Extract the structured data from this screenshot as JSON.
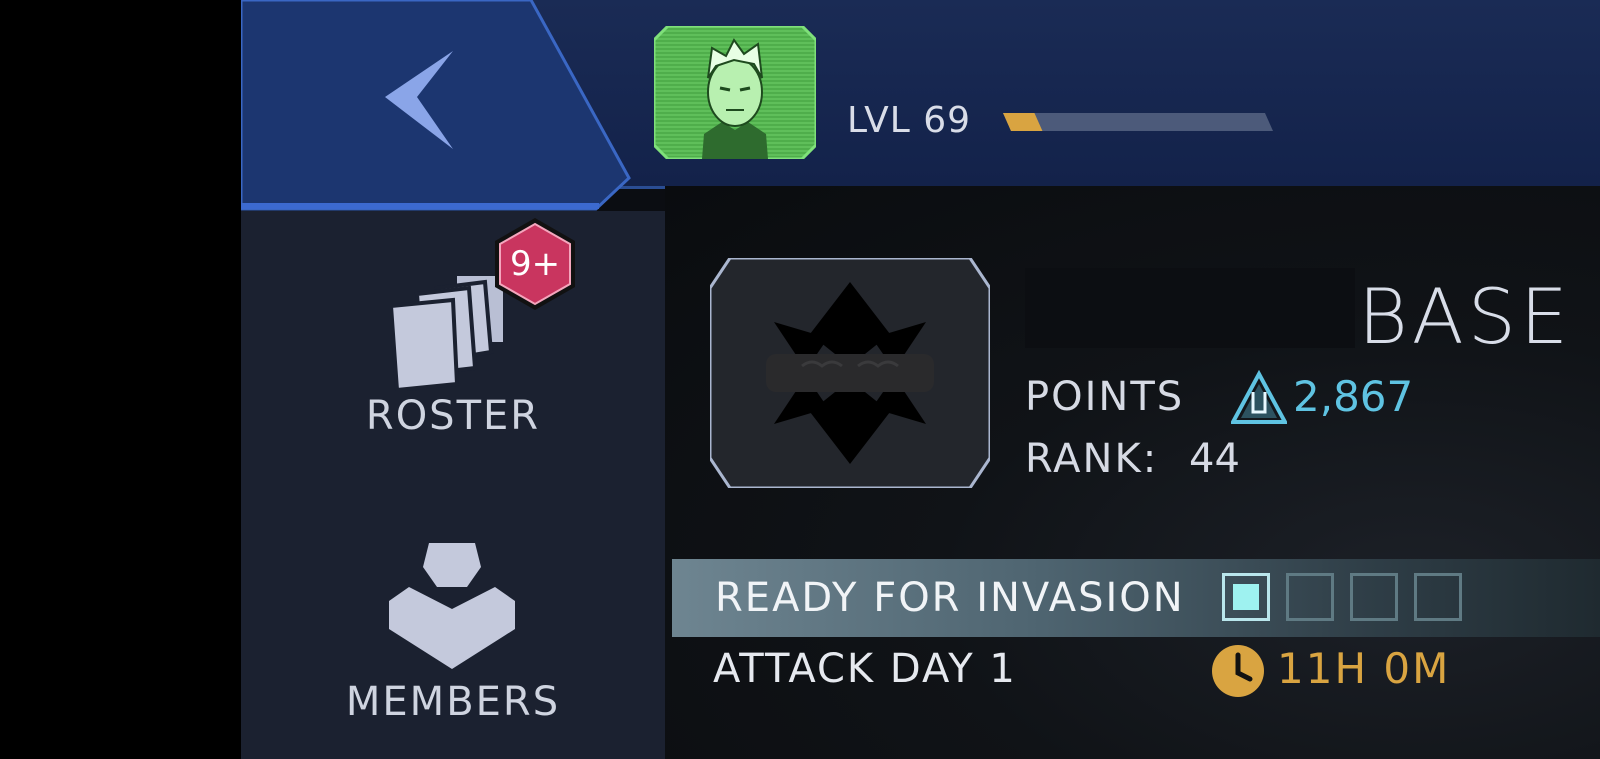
{
  "header": {
    "level_label": "LVL 69",
    "xp_progress": 0.12
  },
  "sidebar": {
    "items": [
      {
        "label": "ROSTER",
        "badge": "9+"
      },
      {
        "label": "MEMBERS"
      }
    ]
  },
  "main": {
    "title": "BASE",
    "points_label": "POINTS",
    "points_value": "2,867",
    "rank_label": "RANK:",
    "rank_value": "44",
    "status_label": "READY FOR INVASION",
    "status_slots": [
      true,
      false,
      false,
      false
    ],
    "attack_label": "ATTACK DAY 1",
    "timer": "11H 0M"
  },
  "colors": {
    "accent_blue": "#2a4d93",
    "points_cyan": "#5fc3e2",
    "timer_gold": "#d9a441",
    "badge_pink": "#c9355f",
    "slot_active": "#9ef2f0"
  },
  "icons": [
    "back-arrow-icon",
    "player-avatar",
    "roster-cards-icon",
    "members-icon",
    "alliance-emblem-icon",
    "points-triangle-icon",
    "clock-icon"
  ]
}
